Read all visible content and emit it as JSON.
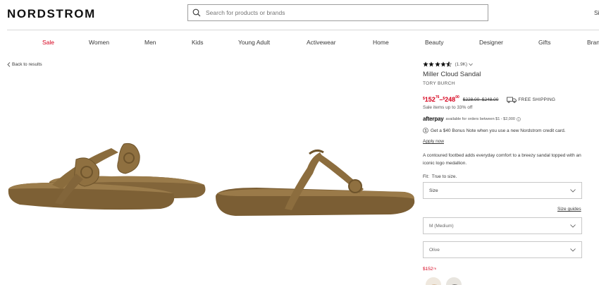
{
  "header": {
    "logo": "NORDSTROM",
    "search_placeholder": "Search for products or brands",
    "signin": "Si"
  },
  "nav": {
    "items": [
      {
        "label": "Sale",
        "highlight": true
      },
      {
        "label": "Women"
      },
      {
        "label": "Men"
      },
      {
        "label": "Kids"
      },
      {
        "label": "Young Adult"
      },
      {
        "label": "Activewear"
      },
      {
        "label": "Home"
      },
      {
        "label": "Beauty"
      },
      {
        "label": "Designer"
      },
      {
        "label": "Gifts"
      },
      {
        "label": "Bran"
      }
    ]
  },
  "back_link": "Back to results",
  "product": {
    "rating": 4.5,
    "review_count": "(1.9K)",
    "title": "Miller Cloud Sandal",
    "brand": "TORY BURCH",
    "price": {
      "sale_low_dollars": "152",
      "sale_low_cents": "76",
      "separator": "–",
      "sale_high_dollars": "248",
      "sale_high_cents": "00",
      "original": "$228.00–$248.00",
      "shipping": "FREE SHIPPING",
      "sale_note": "Sale items up to 33% off"
    },
    "afterpay": {
      "logo": "afterpay",
      "text": "available for orders between $1 - $2,000"
    },
    "bonus_note": "Get a $40 Bonus Note when you use a new Nordstrom credit card.",
    "apply_now": "Apply now",
    "description": "A contoured footbed adds everyday comfort to a breezy sandal topped with an iconic logo medallion.",
    "fit_label": "Fit:",
    "fit_value": "True to size.",
    "size_select": "Size",
    "size_guides": "Size guides",
    "width_select": "M (Medium)",
    "color_select": "Olive",
    "swatch_price_dollars": "152",
    "swatch_price_cents": "76"
  },
  "colors": {
    "sale_red": "#d6001c",
    "sandal": "#8a6a3c"
  },
  "icons": [
    "search-icon",
    "chevron-left-icon",
    "star-icon",
    "chevron-down-icon",
    "truck-icon",
    "info-icon",
    "dollar-circle-icon"
  ]
}
